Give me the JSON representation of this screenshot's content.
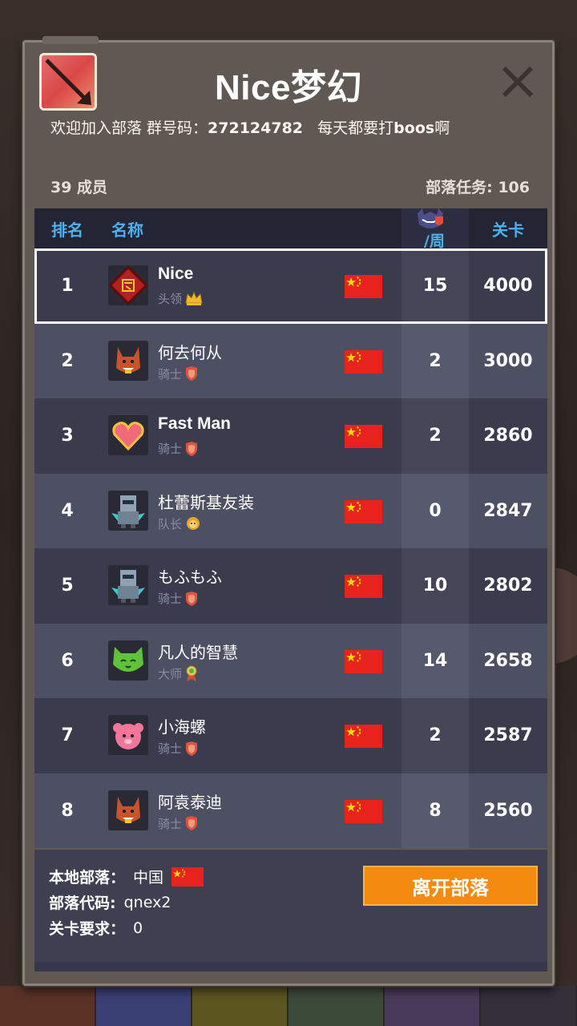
{
  "header": {
    "title": "Nice梦幻",
    "welcome_prefix": "欢迎加入部落 群号码：",
    "group_number": "272124782",
    "welcome_mid": "每天都要打",
    "welcome_bold": "boos",
    "welcome_suffix": "啊",
    "member_count": "39 成员",
    "tribe_task": "部落任务: 106"
  },
  "table": {
    "headers": {
      "rank": "排名",
      "name": "名称",
      "week": "/周",
      "stage": "关卡"
    },
    "rows": [
      {
        "rank": "1",
        "name": "Nice",
        "role": "头领",
        "role_icon": "crown-icon",
        "week": "15",
        "stage": "4000",
        "avatar": "tribe-emblem-avatar"
      },
      {
        "rank": "2",
        "name": "何去何从",
        "role": "骑士",
        "role_icon": "shield-icon",
        "week": "2",
        "stage": "3000",
        "avatar": "fox-avatar"
      },
      {
        "rank": "3",
        "name": "Fast Man",
        "role": "骑士",
        "role_icon": "shield-icon",
        "week": "2",
        "stage": "2860",
        "avatar": "heart-avatar"
      },
      {
        "rank": "4",
        "name": "杜蕾斯基友装",
        "role": "队长",
        "role_icon": "lion-icon",
        "week": "0",
        "stage": "2847",
        "avatar": "robot-avatar"
      },
      {
        "rank": "5",
        "name": "もふもふ",
        "role": "骑士",
        "role_icon": "shield-icon",
        "week": "10",
        "stage": "2802",
        "avatar": "robot-avatar"
      },
      {
        "rank": "6",
        "name": "凡人的智慧",
        "role": "大师",
        "role_icon": "medal-icon",
        "week": "14",
        "stage": "2658",
        "avatar": "green-cat-avatar"
      },
      {
        "rank": "7",
        "name": "小海螺",
        "role": "骑士",
        "role_icon": "shield-icon",
        "week": "2",
        "stage": "2587",
        "avatar": "pink-sheep-avatar"
      },
      {
        "rank": "8",
        "name": "阿袁泰迪",
        "role": "骑士",
        "role_icon": "shield-icon",
        "week": "8",
        "stage": "2560",
        "avatar": "fox-avatar"
      }
    ]
  },
  "footer": {
    "local_tribe_label": "本地部落：",
    "local_tribe_value": "中国",
    "tribe_code_label": "部落代码:",
    "tribe_code_value": "qnex2",
    "stage_req_label": "关卡要求：",
    "stage_req_value": "0",
    "leave_button": "离开部落"
  },
  "colors": {
    "accent_blue": "#4db1ec",
    "leave_orange": "#f58a10",
    "flag_red": "#e8221c",
    "flag_star": "#ffde00"
  }
}
